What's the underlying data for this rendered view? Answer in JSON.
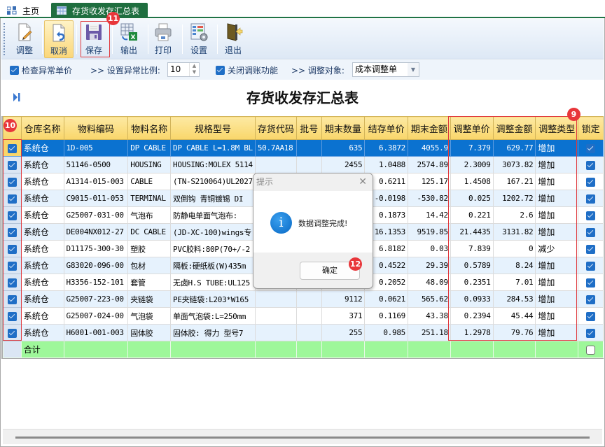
{
  "tabs": [
    {
      "label": "主页",
      "icon": "home-grid-icon",
      "active": false
    },
    {
      "label": "存货收发存汇总表",
      "icon": "table-icon",
      "active": true
    }
  ],
  "toolbar": {
    "buttons": [
      {
        "label": "调整",
        "icon": "edit-document-icon"
      },
      {
        "label": "取消",
        "icon": "undo-document-icon"
      },
      {
        "label": "保存",
        "icon": "save-disk-icon"
      },
      {
        "label": "输出",
        "icon": "export-excel-icon"
      },
      {
        "label": "打印",
        "icon": "printer-icon"
      },
      {
        "label": "设置",
        "icon": "settings-icon"
      },
      {
        "label": "退出",
        "icon": "exit-door-icon"
      }
    ]
  },
  "options": {
    "check_abnormal_price": {
      "label": "检查异常单价",
      "checked": true
    },
    "set_ratio_label": ">> 设置异常比例:",
    "ratio_value": "10",
    "close_adjust": {
      "label": "关闭调账功能",
      "checked": true
    },
    "adjust_target_label": ">> 调整对象:",
    "adjust_target_value": "成本调整单"
  },
  "report": {
    "title": "存货收发存汇总表"
  },
  "grid": {
    "columns": [
      "仓库名称",
      "物料编码",
      "物料名称",
      "规格型号",
      "存货代码",
      "批号",
      "期末数量",
      "结存单价",
      "期末金额",
      "调整单价",
      "调整金额",
      "调整类型",
      "锁定"
    ],
    "rows": [
      {
        "warehouse": "系统仓",
        "code": "1D-005",
        "name": "DP CABLE",
        "spec": "DP CABLE L=1.8M BL",
        "inv_code": "50.7AA18",
        "batch": "",
        "qty": "635",
        "unit_price": "6.3872",
        "amount": "4055.9",
        "adj_price": "7.379",
        "adj_amount": "629.77",
        "adj_type": "增加",
        "checked": true,
        "locked": true
      },
      {
        "warehouse": "系统仓",
        "code": "51146-0500",
        "name": "HOUSING",
        "spec": "HOUSING:MOLEX 5114",
        "inv_code": "",
        "batch": "",
        "qty": "2455",
        "unit_price": "1.0488",
        "amount": "2574.89",
        "adj_price": "2.3009",
        "adj_amount": "3073.82",
        "adj_type": "增加",
        "checked": true,
        "locked": true
      },
      {
        "warehouse": "系统仓",
        "code": "A1314-015-003",
        "name": "CABLE",
        "spec": "(TN-S210064)UL2027",
        "inv_code": "",
        "batch": "",
        "qty": "",
        "unit_price": "0.6211",
        "amount": "125.17",
        "adj_price": "1.4508",
        "adj_amount": "167.21",
        "adj_type": "增加",
        "checked": true,
        "locked": true
      },
      {
        "warehouse": "系统仓",
        "code": "C9015-011-053",
        "name": "TERMINAL",
        "spec": "双倒钩 青铜镀锡 DI",
        "inv_code": "",
        "batch": "",
        "qty": "",
        "unit_price": "-0.0198",
        "amount": "-530.82",
        "adj_price": "0.025",
        "adj_amount": "1202.72",
        "adj_type": "增加",
        "checked": true,
        "locked": true
      },
      {
        "warehouse": "系统仓",
        "code": "G25007-031-00",
        "name": "气泡布",
        "spec": "防静电单面气泡布:",
        "inv_code": "",
        "batch": "",
        "qty": "",
        "unit_price": "0.1873",
        "amount": "14.42",
        "adj_price": "0.221",
        "adj_amount": "2.6",
        "adj_type": "增加",
        "checked": true,
        "locked": true
      },
      {
        "warehouse": "系统仓",
        "code": "DE004NX012-27",
        "name": "DC CABLE",
        "spec": "(JD-XC-100)wings专",
        "inv_code": "",
        "batch": "",
        "qty": "",
        "unit_price": "16.1353",
        "amount": "9519.85",
        "adj_price": "21.4435",
        "adj_amount": "3131.82",
        "adj_type": "增加",
        "checked": true,
        "locked": true
      },
      {
        "warehouse": "系统仓",
        "code": "D11175-300-30",
        "name": "塑胶",
        "spec": "PVC胶料:80P(70+/-2",
        "inv_code": "",
        "batch": "",
        "qty": "",
        "unit_price": "6.8182",
        "amount": "0.03",
        "adj_price": "7.839",
        "adj_amount": "0",
        "adj_type": "减少",
        "checked": true,
        "locked": true
      },
      {
        "warehouse": "系统仓",
        "code": "G83020-096-00",
        "name": "包材",
        "spec": "隔板:硬纸板(W)435m",
        "inv_code": "",
        "batch": "",
        "qty": "",
        "unit_price": "0.4522",
        "amount": "29.39",
        "adj_price": "0.5789",
        "adj_amount": "8.24",
        "adj_type": "增加",
        "checked": true,
        "locked": true
      },
      {
        "warehouse": "系统仓",
        "code": "H3356-152-101",
        "name": "套管",
        "spec": "无卤H.S TUBE:UL125",
        "inv_code": "",
        "batch": "",
        "qty": "",
        "unit_price": "0.2052",
        "amount": "48.09",
        "adj_price": "0.2351",
        "adj_amount": "7.01",
        "adj_type": "增加",
        "checked": true,
        "locked": true
      },
      {
        "warehouse": "系统仓",
        "code": "G25007-223-00",
        "name": "夹链袋",
        "spec": "PE夹链袋:L203*W165",
        "inv_code": "",
        "batch": "",
        "qty": "9112",
        "unit_price": "0.0621",
        "amount": "565.62",
        "adj_price": "0.0933",
        "adj_amount": "284.53",
        "adj_type": "增加",
        "checked": true,
        "locked": true
      },
      {
        "warehouse": "系统仓",
        "code": "G25007-024-00",
        "name": "气泡袋",
        "spec": "单面气泡袋:L=250mm",
        "inv_code": "",
        "batch": "",
        "qty": "371",
        "unit_price": "0.1169",
        "amount": "43.38",
        "adj_price": "0.2394",
        "adj_amount": "45.44",
        "adj_type": "增加",
        "checked": true,
        "locked": true
      },
      {
        "warehouse": "系统仓",
        "code": "H6001-001-003",
        "name": "固体胶",
        "spec": "固体胶: 得力 型号7",
        "inv_code": "",
        "batch": "",
        "qty": "255",
        "unit_price": "0.985",
        "amount": "251.18",
        "adj_price": "1.2978",
        "adj_amount": "79.76",
        "adj_type": "增加",
        "checked": true,
        "locked": true
      }
    ],
    "total_row": {
      "label": "合计",
      "locked": false
    },
    "selected_row_index": 0
  },
  "dialog": {
    "title": "提示",
    "message": "数据调整完成!",
    "ok_label": "确定",
    "icon": "info-icon"
  },
  "annotations": {
    "badge_save": "11",
    "badge_adjust_columns": "9",
    "badge_checkbox_column": "10",
    "badge_ok_button": "12",
    "highlight_color": "#e0393d"
  },
  "colors": {
    "tab_active": "#1f6e3f",
    "header_bg": "#f9d66a",
    "selected_row": "#0b72d0",
    "total_row": "#9ef79a",
    "alt_row": "#e6f2fd"
  }
}
